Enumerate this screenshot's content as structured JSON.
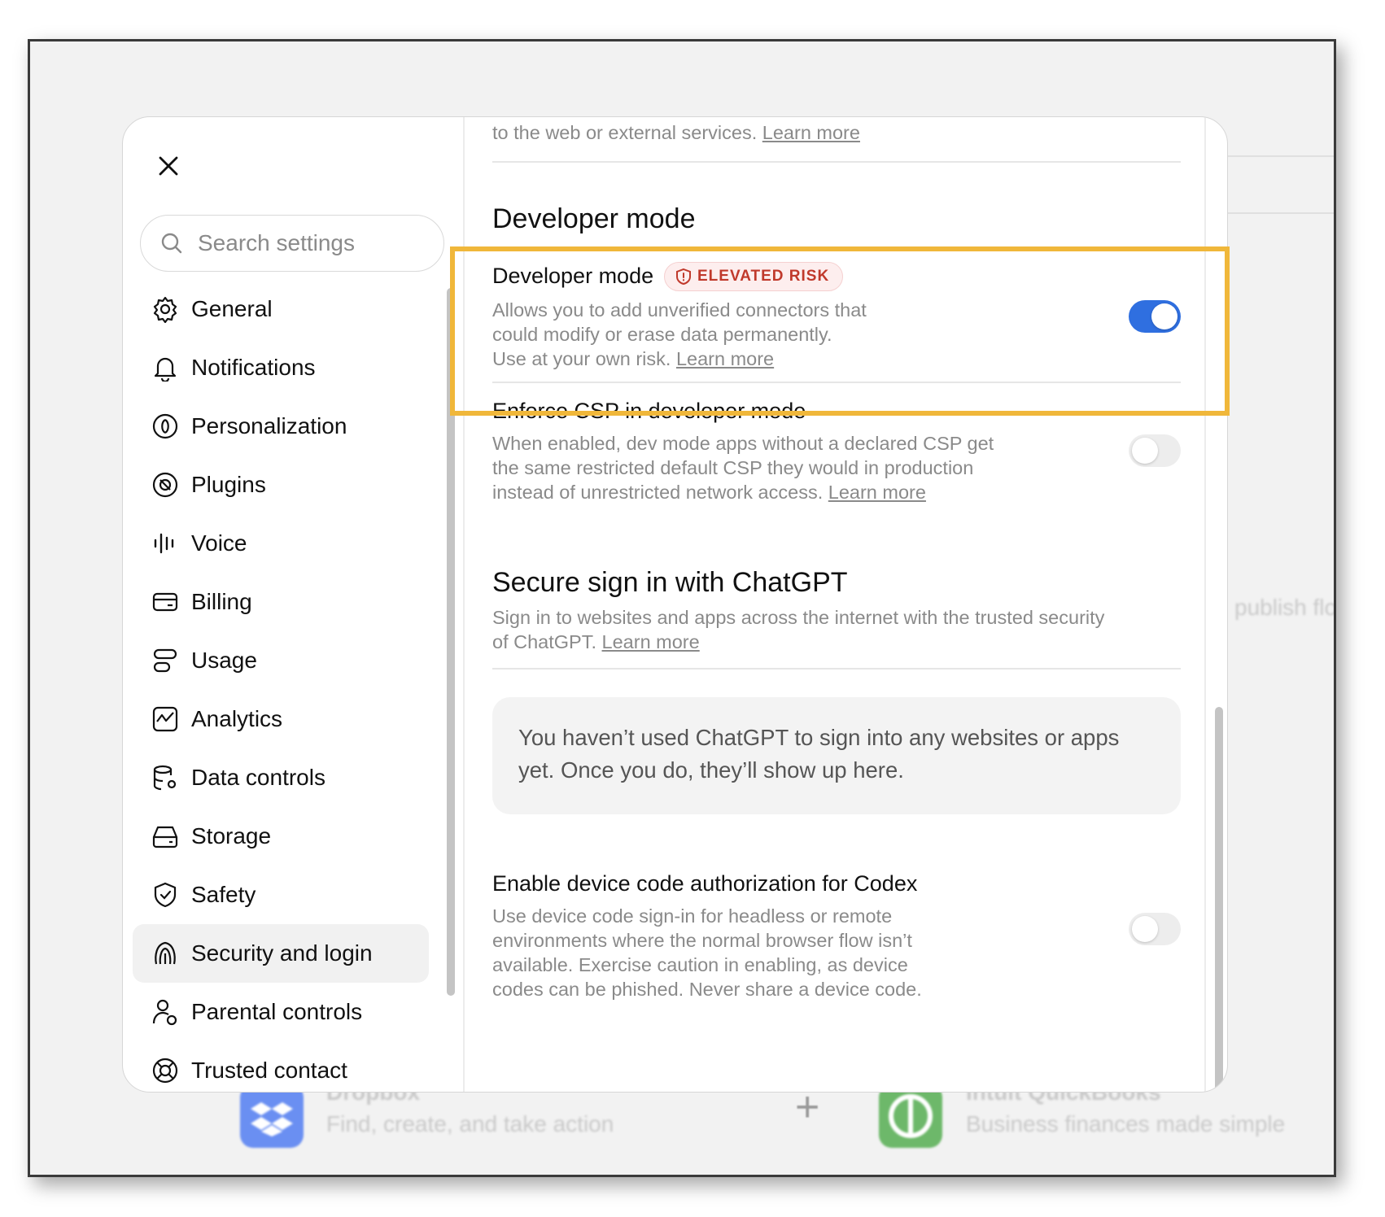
{
  "background": {
    "faded_text_right": "publish flo",
    "app_left": {
      "name": "Dropbox",
      "desc": "Find, create, and take action",
      "color": "#6a8ff2"
    },
    "app_right": {
      "name": "Intuit QuickBooks",
      "desc": "Business finances made simple",
      "color": "#6db86a"
    },
    "plus": "+"
  },
  "sidebar": {
    "search_placeholder": "Search settings",
    "items": [
      {
        "label": "General",
        "icon": "gear-icon"
      },
      {
        "label": "Notifications",
        "icon": "bell-icon"
      },
      {
        "label": "Personalization",
        "icon": "personalization-icon"
      },
      {
        "label": "Plugins",
        "icon": "plugins-icon"
      },
      {
        "label": "Voice",
        "icon": "voice-waveform-icon"
      },
      {
        "label": "Billing",
        "icon": "card-icon"
      },
      {
        "label": "Usage",
        "icon": "usage-icon"
      },
      {
        "label": "Analytics",
        "icon": "analytics-icon"
      },
      {
        "label": "Data controls",
        "icon": "database-gear-icon"
      },
      {
        "label": "Storage",
        "icon": "drive-icon"
      },
      {
        "label": "Safety",
        "icon": "shield-check-icon"
      },
      {
        "label": "Security and login",
        "icon": "security-icon"
      },
      {
        "label": "Parental controls",
        "icon": "parental-icon"
      },
      {
        "label": "Trusted contact",
        "icon": "lifebuoy-icon"
      }
    ],
    "active_index": 11
  },
  "content": {
    "top_fragment": "to the web or external services.",
    "top_fragment_link": "Learn more",
    "dev_section_title": "Developer mode",
    "dev_mode": {
      "title": "Developer mode",
      "badge": "ELEVATED RISK",
      "desc_line1": "Allows you to add unverified connectors that",
      "desc_line2": "could modify or erase data permanently.",
      "desc_line3": "Use at your own risk.",
      "link": "Learn more",
      "enabled": true
    },
    "csp": {
      "title": "Enforce CSP in developer mode",
      "desc_line1": "When enabled, dev mode apps without a declared CSP get",
      "desc_line2": "the same restricted default CSP they would in production",
      "desc_line3": "instead of unrestricted network access.",
      "link": "Learn more",
      "enabled": false
    },
    "secure_signin": {
      "title": "Secure sign in with ChatGPT",
      "desc_line1": "Sign in to websites and apps across the internet with the trusted security",
      "desc_line2": "of ChatGPT.",
      "link": "Learn more",
      "empty_line1": "You haven’t used ChatGPT to sign into any websites or apps",
      "empty_line2": "yet. Once you do, they’ll show up here."
    },
    "device_code": {
      "title": "Enable device code authorization for Codex",
      "desc_line1": "Use device code sign-in for headless or remote",
      "desc_line2": "environments where the normal browser flow isn’t",
      "desc_line3": "available. Exercise caution in enabling, as device",
      "desc_line4": "codes can be phished. Never share a device code.",
      "enabled": false
    }
  },
  "colors": {
    "accent": "#2f6fe0",
    "highlight": "#f0b73a",
    "risk": "#c0392b"
  }
}
